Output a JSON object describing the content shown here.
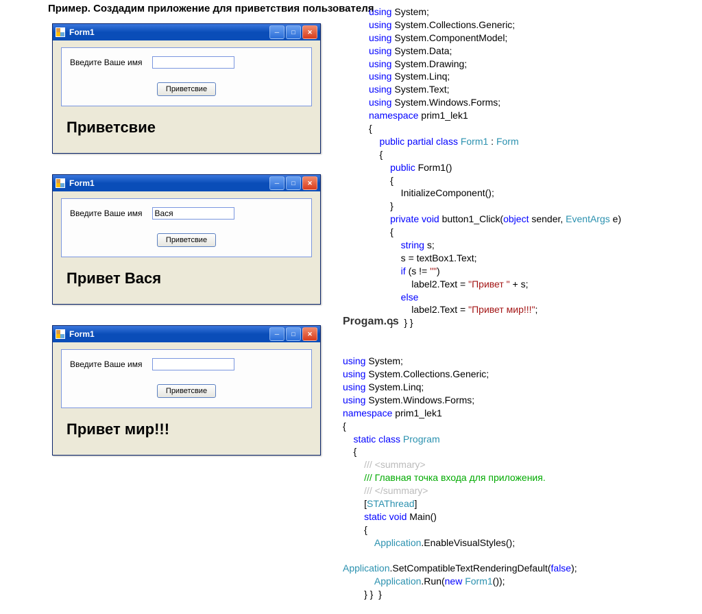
{
  "title": "Пример. Создадим приложение для приветствия пользователя",
  "forms": [
    {
      "title": "Form1",
      "label": "Введите Ваше имя",
      "input": "",
      "button": "Приветсвие",
      "result": "Приветсвие"
    },
    {
      "title": "Form1",
      "label": "Введите Ваше имя",
      "input": "Вася",
      "button": "Приветсвие",
      "result": "Привет Вася"
    },
    {
      "title": "Form1",
      "label": "Введите Ваше имя",
      "input": "",
      "button": "Приветсвие",
      "result": "Привет мир!!!"
    }
  ],
  "code1": [
    {
      "t": "using ",
      "c": "kw"
    },
    {
      "t": "System;\n"
    },
    {
      "t": "using ",
      "c": "kw"
    },
    {
      "t": "System.Collections.Generic;\n"
    },
    {
      "t": "using ",
      "c": "kw"
    },
    {
      "t": "System.ComponentModel;\n"
    },
    {
      "t": "using ",
      "c": "kw"
    },
    {
      "t": "System.Data;\n"
    },
    {
      "t": "using ",
      "c": "kw"
    },
    {
      "t": "System.Drawing;\n"
    },
    {
      "t": "using ",
      "c": "kw"
    },
    {
      "t": "System.Linq;\n"
    },
    {
      "t": "using ",
      "c": "kw"
    },
    {
      "t": "System.Text;\n"
    },
    {
      "t": "using ",
      "c": "kw"
    },
    {
      "t": "System.Windows.Forms;\n"
    },
    {
      "t": "namespace ",
      "c": "kw"
    },
    {
      "t": "prim1_lek1\n"
    },
    {
      "t": "{\n"
    },
    {
      "t": "    public partial class ",
      "c": "kw"
    },
    {
      "t": "Form1",
      "c": "typ"
    },
    {
      "t": " : "
    },
    {
      "t": "Form",
      "c": "typ"
    },
    {
      "t": "\n"
    },
    {
      "t": "    {\n"
    },
    {
      "t": "        public ",
      "c": "kw"
    },
    {
      "t": "Form1()\n"
    },
    {
      "t": "        {\n"
    },
    {
      "t": "            InitializeComponent();\n"
    },
    {
      "t": "        }\n"
    },
    {
      "t": "        private void ",
      "c": "kw"
    },
    {
      "t": "button1_Click("
    },
    {
      "t": "object",
      "c": "kw"
    },
    {
      "t": " sender, "
    },
    {
      "t": "EventArgs",
      "c": "typ"
    },
    {
      "t": " e)\n"
    },
    {
      "t": "        {\n"
    },
    {
      "t": "            string ",
      "c": "kw"
    },
    {
      "t": "s;\n"
    },
    {
      "t": "            s = textBox1.Text;\n"
    },
    {
      "t": "            if ",
      "c": "kw"
    },
    {
      "t": "(s != "
    },
    {
      "t": "\"\"",
      "c": "str"
    },
    {
      "t": ")\n"
    },
    {
      "t": "                label2.Text = "
    },
    {
      "t": "\"Привет \"",
      "c": "str"
    },
    {
      "t": " + s;\n"
    },
    {
      "t": "            else",
      "c": "kw"
    },
    {
      "t": "\n"
    },
    {
      "t": "                label2.Text = "
    },
    {
      "t": "\"Привет мир!!!\"",
      "c": "str"
    },
    {
      "t": ";\n"
    },
    {
      "t": "        }    } }\n"
    }
  ],
  "prog_title": "Progam.cs",
  "code2": [
    {
      "t": "using ",
      "c": "kw"
    },
    {
      "t": "System;\n"
    },
    {
      "t": "using ",
      "c": "kw"
    },
    {
      "t": "System.Collections.Generic;\n"
    },
    {
      "t": "using ",
      "c": "kw"
    },
    {
      "t": "System.Linq;\n"
    },
    {
      "t": "using ",
      "c": "kw"
    },
    {
      "t": "System.Windows.Forms;\n"
    },
    {
      "t": "namespace ",
      "c": "kw"
    },
    {
      "t": "prim1_lek1\n"
    },
    {
      "t": "{\n"
    },
    {
      "t": "    static class ",
      "c": "kw"
    },
    {
      "t": "Program",
      "c": "typ"
    },
    {
      "t": "\n"
    },
    {
      "t": "    {\n"
    },
    {
      "t": "        /// <summary>",
      "c": "com"
    },
    {
      "t": "\n"
    },
    {
      "t": "        /// Главная точка входа для приложения.",
      "c": "grn"
    },
    {
      "t": "\n"
    },
    {
      "t": "        /// </summary>",
      "c": "com"
    },
    {
      "t": "\n"
    },
    {
      "t": "        ["
    },
    {
      "t": "STAThread",
      "c": "typ"
    },
    {
      "t": "]\n"
    },
    {
      "t": "        static void ",
      "c": "kw"
    },
    {
      "t": "Main()\n"
    },
    {
      "t": "        {\n"
    },
    {
      "t": "            Application",
      "c": "typ"
    },
    {
      "t": ".EnableVisualStyles();\n"
    },
    {
      "t": "\n"
    },
    {
      "t": "Application",
      "c": "typ"
    },
    {
      "t": ".SetCompatibleTextRenderingDefault("
    },
    {
      "t": "false",
      "c": "kw"
    },
    {
      "t": ");\n"
    },
    {
      "t": "            Application",
      "c": "typ"
    },
    {
      "t": ".Run("
    },
    {
      "t": "new ",
      "c": "kw"
    },
    {
      "t": "Form1",
      "c": "typ"
    },
    {
      "t": "());\n"
    },
    {
      "t": "        } }  }\n"
    }
  ]
}
